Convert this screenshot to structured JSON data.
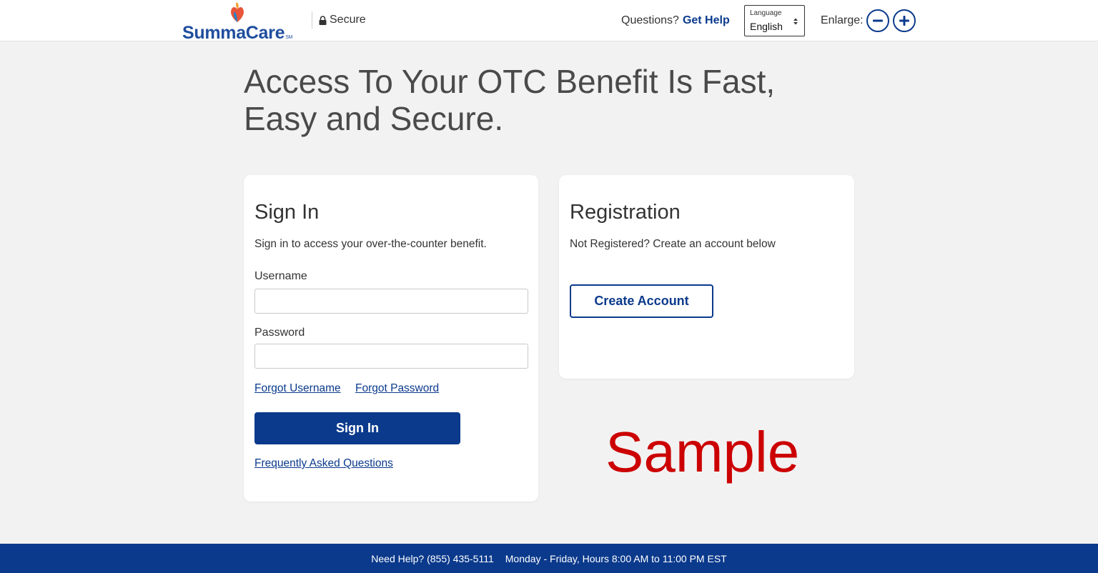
{
  "header": {
    "logo_text": "SummaCare",
    "logo_mark_text": "SM",
    "secure_label": "Secure",
    "help_prefix": "Questions?",
    "help_link": "Get Help",
    "language": {
      "label": "Language",
      "selected": "English"
    },
    "enlarge_label": "Enlarge:",
    "icons": [
      "logo-icon",
      "lock-icon",
      "select-arrows-icon",
      "minus-icon",
      "plus-icon"
    ]
  },
  "hero": {
    "title_line1": "Access To Your OTC Benefit Is Fast,",
    "title_line2": "Easy and Secure."
  },
  "signin": {
    "title": "Sign In",
    "subtitle": "Sign in to access your over-the-counter benefit.",
    "username_label": "Username",
    "username_value": "",
    "password_label": "Password",
    "password_value": "",
    "forgot_username": "Forgot Username",
    "forgot_password": "Forgot Password",
    "submit_label": "Sign In",
    "faq_link": "Frequently Asked Questions"
  },
  "registration": {
    "title": "Registration",
    "subtitle": "Not Registered? Create an account below",
    "create_label": "Create Account"
  },
  "watermark": "Sample",
  "footer": {
    "help": "Need Help?  (855) 435-5111",
    "hours": "Monday - Friday, Hours 8:00 AM to 11:00 PM EST"
  },
  "colors": {
    "brand_blue": "#0b3a8c",
    "background": "#f2f2f2",
    "watermark_red": "#cc0000"
  }
}
